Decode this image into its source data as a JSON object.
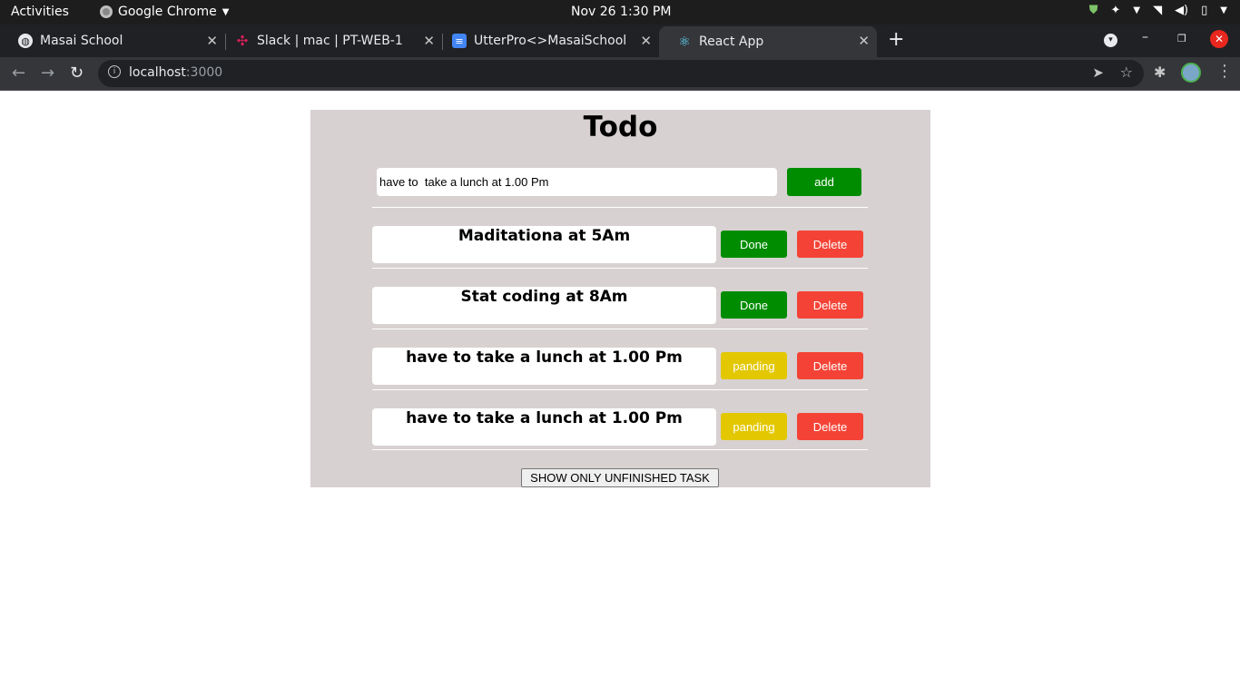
{
  "os_bar": {
    "activities": "Activities",
    "app_name": "Google Chrome",
    "clock": "Nov 26   1:30 PM"
  },
  "browser": {
    "tabs": [
      {
        "title": "Masai School",
        "icon": "globe-icon"
      },
      {
        "title": "Slack | mac | PT-WEB-1",
        "icon": "slack-icon"
      },
      {
        "title": "UtterPro<>MasaiSchool: F",
        "icon": "docs-icon"
      },
      {
        "title": "React App",
        "icon": "react-icon",
        "active": true
      }
    ],
    "url_host": "localhost",
    "url_port": ":3000"
  },
  "app": {
    "title": "Todo",
    "input_value": "have to  take a lunch at 1.00 Pm",
    "add_label": "add",
    "todos": [
      {
        "text": "Maditationa at 5Am",
        "status_label": "Done",
        "delete_label": "Delete"
      },
      {
        "text": "Stat coding at 8Am",
        "status_label": "Done",
        "delete_label": "Delete"
      },
      {
        "text": "have to take a lunch at 1.00 Pm",
        "status_label": "panding",
        "delete_label": "Delete"
      },
      {
        "text": "have to take a lunch at 1.00 Pm",
        "status_label": "panding",
        "delete_label": "Delete"
      }
    ],
    "filter_label": "SHOW ONLY UNFINISHED TASK"
  },
  "colors": {
    "app_bg": "#d8d1d1",
    "done": "#008c00",
    "pending": "#e3c700",
    "delete": "#f44336"
  }
}
